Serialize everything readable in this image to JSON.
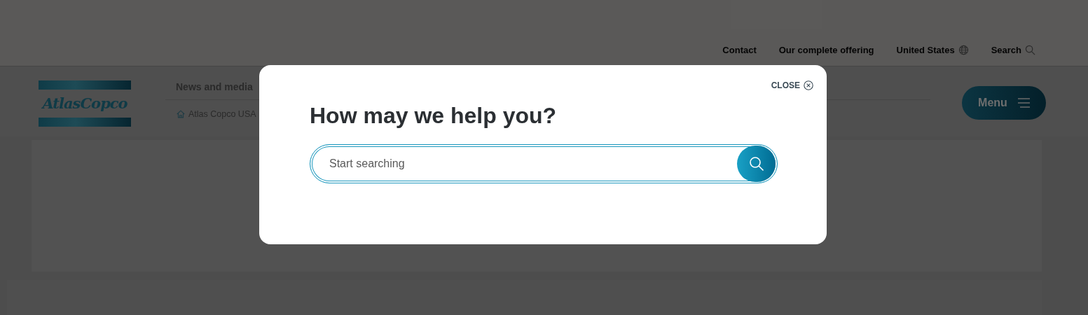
{
  "utility_nav": [
    {
      "label": "Contact",
      "kind": "link"
    },
    {
      "label": "Our complete offering",
      "kind": "link"
    },
    {
      "label": "United States",
      "kind": "locale"
    },
    {
      "label": "Search",
      "kind": "search"
    }
  ],
  "header": {
    "logo": "AtlasCopco",
    "nav_item": "News and media",
    "breadcrumb": "Atlas Copco USA",
    "menu_button": "Menu"
  },
  "modal": {
    "close": "CLOSE",
    "title": "How may we help you?",
    "search": {
      "placeholder": "Start searching"
    }
  }
}
